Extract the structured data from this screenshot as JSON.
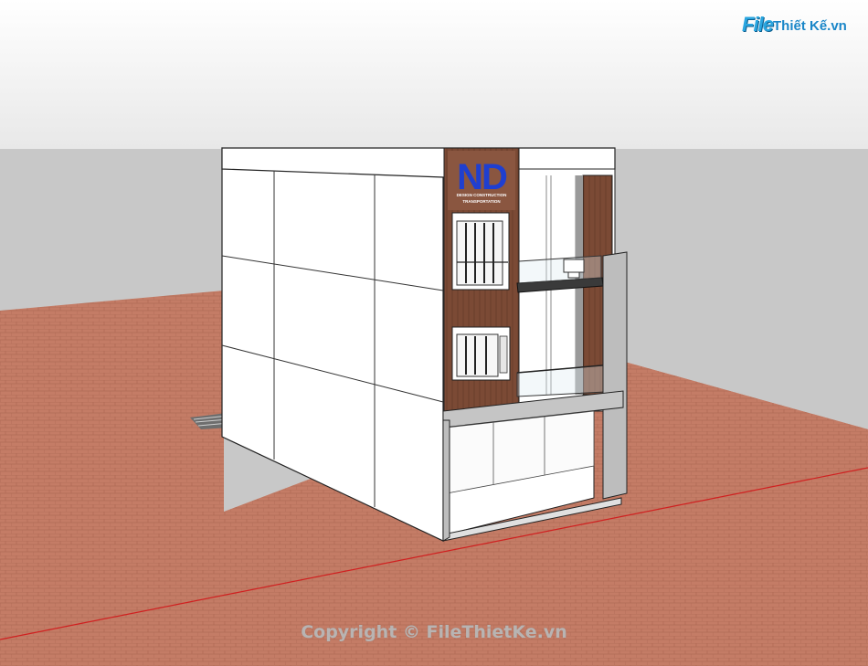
{
  "watermark": {
    "brand_file": "File",
    "brand_rest": "Thiết Kế.vn"
  },
  "sign": {
    "logo_text": "ND",
    "line1": "DESIGN CONSTRUCTION",
    "line2": "TRANSPORTATION"
  },
  "footer": {
    "copyright": "Copyright © FileThietKe.vn"
  },
  "colors": {
    "sky": "#f3f3f3",
    "ground": "#c77f68",
    "wall": "#ffffff",
    "wood": "#7b4a35",
    "concrete": "#bdbdbd",
    "logo_blue": "#1f3fd0",
    "axis_red": "#d02020"
  }
}
